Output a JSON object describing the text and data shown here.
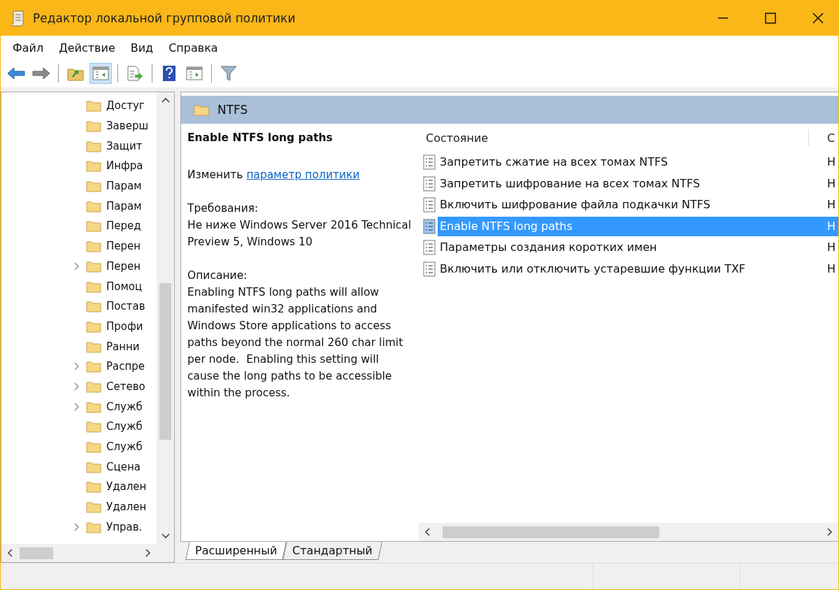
{
  "window": {
    "title": "Редактор локальной групповой политики"
  },
  "menu": [
    "Файл",
    "Действие",
    "Вид",
    "Справка"
  ],
  "toolbar": [
    [
      {
        "kind": "back",
        "selected": false
      },
      {
        "kind": "forward",
        "selected": false
      }
    ],
    [
      {
        "kind": "up",
        "selected": false
      },
      {
        "kind": "tree",
        "selected": true
      }
    ],
    [
      {
        "kind": "export",
        "selected": false
      }
    ],
    [
      {
        "kind": "help",
        "selected": false
      },
      {
        "kind": "pane",
        "selected": false
      }
    ],
    [
      {
        "kind": "filter",
        "selected": false
      }
    ]
  ],
  "tree": {
    "items": [
      {
        "label": "Достуг",
        "expandable": false
      },
      {
        "label": "Заверш",
        "expandable": false
      },
      {
        "label": "Защит",
        "expandable": false
      },
      {
        "label": "Инфра",
        "expandable": false
      },
      {
        "label": "Парам",
        "expandable": false
      },
      {
        "label": "Парам",
        "expandable": false
      },
      {
        "label": "Перед",
        "expandable": false
      },
      {
        "label": "Перен",
        "expandable": false
      },
      {
        "label": "Перен",
        "expandable": true
      },
      {
        "label": "Помоц",
        "expandable": false
      },
      {
        "label": "Постав",
        "expandable": false
      },
      {
        "label": "Профи",
        "expandable": false
      },
      {
        "label": "Ранни",
        "expandable": false
      },
      {
        "label": "Распре",
        "expandable": true
      },
      {
        "label": "Сетево",
        "expandable": true
      },
      {
        "label": "Служб",
        "expandable": true
      },
      {
        "label": "Служб",
        "expandable": false
      },
      {
        "label": "Служб",
        "expandable": false
      },
      {
        "label": "Сцена",
        "expandable": false
      },
      {
        "label": "Удален",
        "expandable": false
      },
      {
        "label": "Удален",
        "expandable": false
      },
      {
        "label": "Управ.",
        "expandable": true
      }
    ]
  },
  "header": {
    "title": "NTFS"
  },
  "description": {
    "title": "Enable NTFS long paths",
    "edit_prefix": "Изменить",
    "edit_link": "параметр политики",
    "requirements_label": "Требования:",
    "requirements": "Не ниже Windows Server 2016 Technical Preview 5, Windows 10",
    "description_label": "Описание:",
    "text": "Enabling NTFS long paths will allow manifested win32 applications and Windows Store applications to access paths beyond the normal 260 char limit per node.  Enabling this setting will cause the long paths to be accessible within the process."
  },
  "table": {
    "columns": [
      "Состояние",
      "С"
    ],
    "rows": [
      {
        "name": "Запретить сжатие на всех томах NTFS",
        "column_2": "Н",
        "selected": false
      },
      {
        "name": "Запретить шифрование на всех томах NTFS",
        "column_2": "Н",
        "selected": false
      },
      {
        "name": "Включить шифрование файла подкачки NTFS",
        "column_2": "Н",
        "selected": false
      },
      {
        "name": "Enable NTFS long paths",
        "column_2": "Н",
        "selected": true
      },
      {
        "name": "Параметры создания коротких имен",
        "column_2": "Н",
        "selected": false
      },
      {
        "name": "Включить или отключить устаревшие функции TXF",
        "column_2": "Н",
        "selected": false
      }
    ]
  },
  "tabs": [
    {
      "label": "Расширенный",
      "selected": true
    },
    {
      "label": "Стандартный",
      "selected": false
    }
  ]
}
